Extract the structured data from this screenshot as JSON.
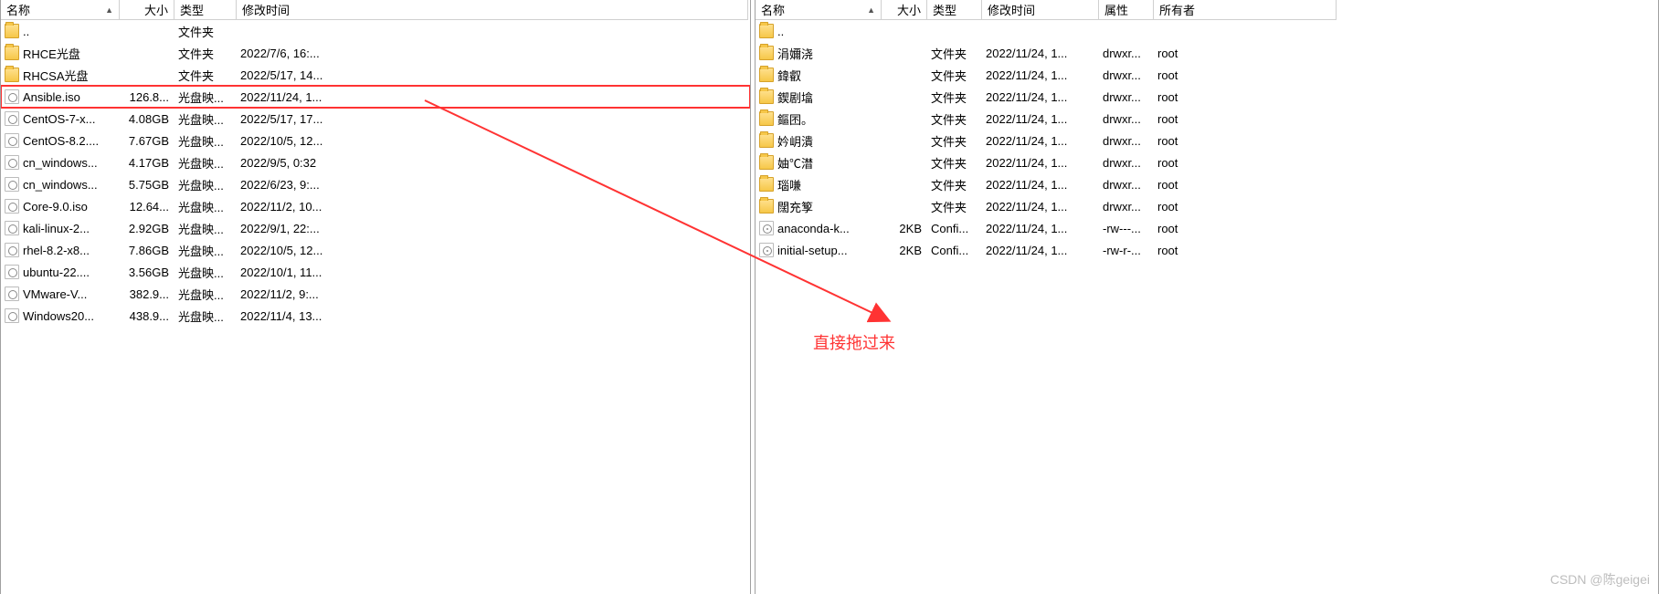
{
  "left": {
    "headers": {
      "name": "名称",
      "size": "大小",
      "type": "类型",
      "date": "修改时间"
    },
    "rows": [
      {
        "icon": "folder-up",
        "name": "..",
        "size": "",
        "type": "文件夹",
        "date": "",
        "hl": false
      },
      {
        "icon": "folder",
        "name": "RHCE光盘",
        "size": "",
        "type": "文件夹",
        "date": "2022/7/6, 16:...",
        "hl": false
      },
      {
        "icon": "folder",
        "name": "RHCSA光盘",
        "size": "",
        "type": "文件夹",
        "date": "2022/5/17, 14...",
        "hl": false
      },
      {
        "icon": "iso",
        "name": "Ansible.iso",
        "size": "126.8...",
        "type": "光盘映...",
        "date": "2022/11/24, 1...",
        "hl": true
      },
      {
        "icon": "iso",
        "name": "CentOS-7-x...",
        "size": "4.08GB",
        "type": "光盘映...",
        "date": "2022/5/17, 17...",
        "hl": false
      },
      {
        "icon": "iso",
        "name": "CentOS-8.2....",
        "size": "7.67GB",
        "type": "光盘映...",
        "date": "2022/10/5, 12...",
        "hl": false
      },
      {
        "icon": "iso",
        "name": "cn_windows...",
        "size": "4.17GB",
        "type": "光盘映...",
        "date": "2022/9/5, 0:32",
        "hl": false
      },
      {
        "icon": "iso",
        "name": "cn_windows...",
        "size": "5.75GB",
        "type": "光盘映...",
        "date": "2022/6/23, 9:...",
        "hl": false
      },
      {
        "icon": "iso",
        "name": "Core-9.0.iso",
        "size": "12.64...",
        "type": "光盘映...",
        "date": "2022/11/2, 10...",
        "hl": false
      },
      {
        "icon": "iso",
        "name": "kali-linux-2...",
        "size": "2.92GB",
        "type": "光盘映...",
        "date": "2022/9/1, 22:...",
        "hl": false
      },
      {
        "icon": "iso",
        "name": "rhel-8.2-x8...",
        "size": "7.86GB",
        "type": "光盘映...",
        "date": "2022/10/5, 12...",
        "hl": false
      },
      {
        "icon": "iso",
        "name": "ubuntu-22....",
        "size": "3.56GB",
        "type": "光盘映...",
        "date": "2022/10/1, 11...",
        "hl": false
      },
      {
        "icon": "iso",
        "name": "VMware-V...",
        "size": "382.9...",
        "type": "光盘映...",
        "date": "2022/11/2, 9:...",
        "hl": false
      },
      {
        "icon": "iso",
        "name": "Windows20...",
        "size": "438.9...",
        "type": "光盘映...",
        "date": "2022/11/4, 13...",
        "hl": false
      }
    ]
  },
  "right": {
    "headers": {
      "name": "名称",
      "size": "大小",
      "type": "类型",
      "date": "修改时间",
      "attr": "属性",
      "owner": "所有者"
    },
    "rows": [
      {
        "icon": "folder-up",
        "name": "..",
        "size": "",
        "type": "",
        "date": "",
        "attr": "",
        "owner": ""
      },
      {
        "icon": "folder",
        "name": "涓嬭浇",
        "size": "",
        "type": "文件夹",
        "date": "2022/11/24, 1...",
        "attr": "drwxr...",
        "owner": "root"
      },
      {
        "icon": "folder",
        "name": "鍏叡",
        "size": "",
        "type": "文件夹",
        "date": "2022/11/24, 1...",
        "attr": "drwxr...",
        "owner": "root"
      },
      {
        "icon": "folder",
        "name": "鍥剧墖",
        "size": "",
        "type": "文件夹",
        "date": "2022/11/24, 1...",
        "attr": "drwxr...",
        "owner": "root"
      },
      {
        "icon": "folder",
        "name": "鏂囨。",
        "size": "",
        "type": "文件夹",
        "date": "2022/11/24, 1...",
        "attr": "drwxr...",
        "owner": "root"
      },
      {
        "icon": "folder",
        "name": "妗岄潰",
        "size": "",
        "type": "文件夹",
        "date": "2022/11/24, 1...",
        "attr": "drwxr...",
        "owner": "root"
      },
      {
        "icon": "folder",
        "name": "妯℃澘",
        "size": "",
        "type": "文件夹",
        "date": "2022/11/24, 1...",
        "attr": "drwxr...",
        "owner": "root"
      },
      {
        "icon": "folder",
        "name": "瑙嗛",
        "size": "",
        "type": "文件夹",
        "date": "2022/11/24, 1...",
        "attr": "drwxr...",
        "owner": "root"
      },
      {
        "icon": "folder",
        "name": "闊充箰",
        "size": "",
        "type": "文件夹",
        "date": "2022/11/24, 1...",
        "attr": "drwxr...",
        "owner": "root"
      },
      {
        "icon": "cfg",
        "name": "anaconda-k...",
        "size": "2KB",
        "type": "Confi...",
        "date": "2022/11/24, 1...",
        "attr": "-rw---...",
        "owner": "root"
      },
      {
        "icon": "cfg",
        "name": "initial-setup...",
        "size": "2KB",
        "type": "Confi...",
        "date": "2022/11/24, 1...",
        "attr": "-rw-r-...",
        "owner": "root"
      }
    ]
  },
  "annotation": "直接拖过来",
  "watermark": "CSDN @陈geigei"
}
